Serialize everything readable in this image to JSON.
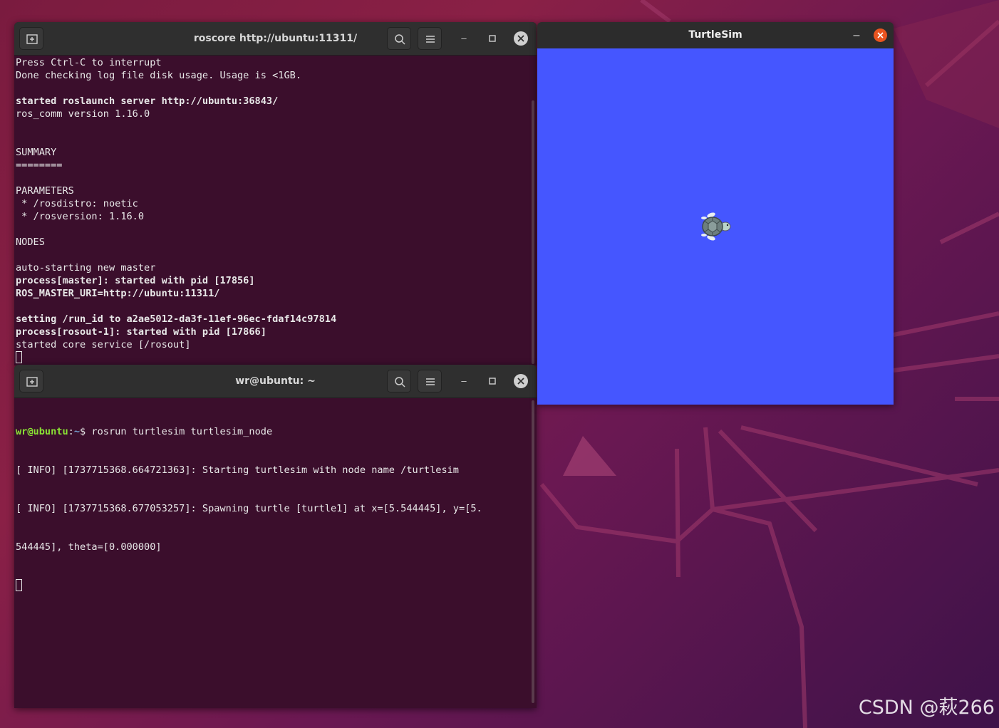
{
  "desktop": {
    "watermark": "CSDN @萩266"
  },
  "roscore_terminal": {
    "title": "roscore http://ubuntu:11311/",
    "lines": [
      {
        "text": "Press Ctrl-C to interrupt",
        "bold": false
      },
      {
        "text": "Done checking log file disk usage. Usage is <1GB.",
        "bold": false
      },
      {
        "text": "",
        "bold": false
      },
      {
        "text": "started roslaunch server http://ubuntu:36843/",
        "bold": true
      },
      {
        "text": "ros_comm version 1.16.0",
        "bold": false
      },
      {
        "text": "",
        "bold": false
      },
      {
        "text": "",
        "bold": false
      },
      {
        "text": "SUMMARY",
        "bold": false
      },
      {
        "text": "========",
        "bold": false
      },
      {
        "text": "",
        "bold": false
      },
      {
        "text": "PARAMETERS",
        "bold": false
      },
      {
        "text": " * /rosdistro: noetic",
        "bold": false
      },
      {
        "text": " * /rosversion: 1.16.0",
        "bold": false
      },
      {
        "text": "",
        "bold": false
      },
      {
        "text": "NODES",
        "bold": false
      },
      {
        "text": "",
        "bold": false
      },
      {
        "text": "auto-starting new master",
        "bold": false
      },
      {
        "text": "process[master]: started with pid [17856]",
        "bold": true
      },
      {
        "text": "ROS_MASTER_URI=http://ubuntu:11311/",
        "bold": true
      },
      {
        "text": "",
        "bold": false
      },
      {
        "text": "setting /run_id to a2ae5012-da3f-11ef-96ec-fdaf14c97814",
        "bold": true
      },
      {
        "text": "process[rosout-1]: started with pid [17866]",
        "bold": true
      },
      {
        "text": "started core service [/rosout]",
        "bold": false
      }
    ]
  },
  "turtlesim_terminal": {
    "title": "wr@ubuntu: ~",
    "prompt_user": "wr@ubuntu",
    "prompt_colon": ":",
    "prompt_path": "~",
    "prompt_symbol": "$ ",
    "command": "rosrun turtlesim turtlesim_node",
    "lines": [
      "[ INFO] [1737715368.664721363]: Starting turtlesim with node name /turtlesim",
      "[ INFO] [1737715368.677053257]: Spawning turtle [turtle1] at x=[5.544445], y=[5.",
      "544445], theta=[0.000000]"
    ]
  },
  "turtlesim_window": {
    "title": "TurtleSim",
    "background_color": "#4556ff",
    "turtle_name": "turtle1"
  },
  "icons": {
    "new_tab": "new-tab-icon",
    "search": "search-icon",
    "menu": "hamburger-menu-icon",
    "minimize": "minimize-icon",
    "maximize": "maximize-icon",
    "close": "close-icon",
    "turtle": "turtle-icon"
  }
}
